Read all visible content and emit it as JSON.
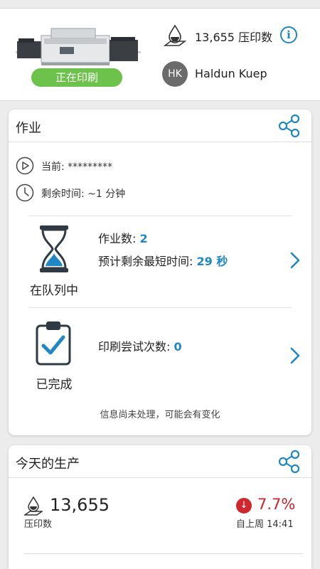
{
  "header": {
    "press_status": "正在印刷",
    "impressions_text": "13,655 压印数",
    "info_icon_glyph": "i",
    "user_initials": "HK",
    "user_name": "Haldun Kuep"
  },
  "jobs": {
    "title": "作业",
    "current_label": "当前: *********",
    "remaining_time_label": "剩余时间: ~1 分钟",
    "queued": {
      "label": "在队列中",
      "job_count_label": "作业数: ",
      "job_count_value": "2",
      "min_time_label": "预计剩余最短时间: ",
      "min_time_value": "29 秒"
    },
    "completed": {
      "label": "已完成",
      "attempts_label": "印刷尝试次数: ",
      "attempts_value": "0"
    },
    "note": "信息尚未处理，可能会有变化"
  },
  "production": {
    "title": "今天的生产",
    "impressions_value": "13,655",
    "impressions_label": "压印数",
    "trend_glyph": "↓",
    "change_pct": "7.7%",
    "since_label": "自上周 14:41"
  },
  "icons": [
    "ink-drop-icon",
    "info-icon",
    "share-icon",
    "play-icon",
    "clock-icon",
    "hourglass-icon",
    "clipboard-check-icon",
    "chevron-right-icon",
    "down-arrow-icon"
  ],
  "colors": {
    "accent": "#1f87c4",
    "status_green": "#6cc24a",
    "negative_red": "#c8232b",
    "hourglass_blue": "#1f87c4",
    "background": "#ececec"
  }
}
